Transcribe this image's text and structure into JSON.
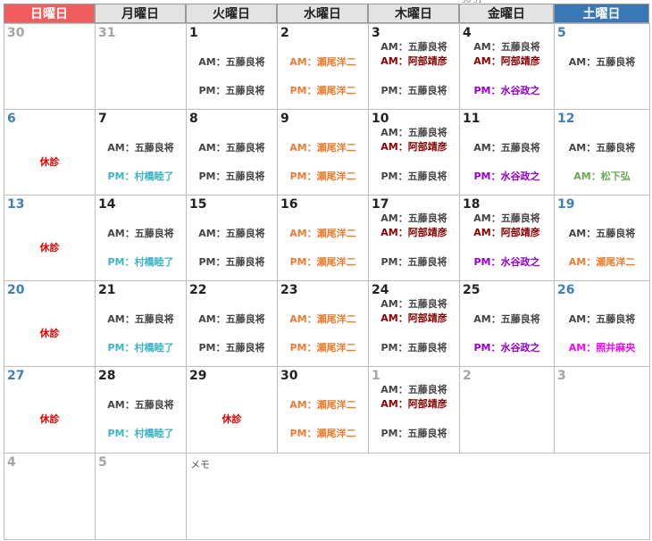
{
  "headers": [
    {
      "label": "日曜日",
      "bg": "#f25c5c",
      "fg": "#ffffff"
    },
    {
      "label": "月曜日",
      "bg": "#e3e3e3",
      "fg": "#222222"
    },
    {
      "label": "火曜日",
      "bg": "#e3e3e3",
      "fg": "#222222"
    },
    {
      "label": "水曜日",
      "bg": "#e3e3e3",
      "fg": "#222222"
    },
    {
      "label": "木曜日",
      "bg": "#e3e3e3",
      "fg": "#222222"
    },
    {
      "label": "金曜日",
      "bg": "#e3e3e3",
      "fg": "#222222"
    },
    {
      "label": "土曜日",
      "bg": "#3a78b5",
      "fg": "#ffffff"
    }
  ],
  "top_note": "30 31",
  "colors": {
    "dark": "#222222",
    "gray": "#a5a5a5",
    "sunday": "#3f7fb5",
    "saturday": "#3f7fb5",
    "holiday": "#dd0000",
    "am5": "#444444",
    "pm5": "#444444",
    "seo": "#ed7d31",
    "abe": "#8b0000",
    "mizu": "#9900cc",
    "mura": "#3ab4c6",
    "matsu": "#6aa84f",
    "teru": "#ff00ff"
  },
  "memo": "メモ",
  "weeks": [
    [
      {
        "n": "30",
        "nc": "gray",
        "lines": []
      },
      {
        "n": "31",
        "nc": "gray",
        "lines": []
      },
      {
        "n": "1",
        "nc": "dark",
        "lines": [
          {
            "t": "AM：五藤良将",
            "c": "am5",
            "y": 36
          },
          {
            "t": "PM：五藤良将",
            "c": "pm5",
            "y": 68
          }
        ]
      },
      {
        "n": "2",
        "nc": "dark",
        "lines": [
          {
            "t": "AM：瀬尾洋二",
            "c": "seo",
            "y": 36
          },
          {
            "t": "PM：瀬尾洋二",
            "c": "seo",
            "y": 68
          }
        ]
      },
      {
        "n": "3",
        "nc": "dark",
        "lines": [
          {
            "t": "AM：五藤良将",
            "c": "am5",
            "y": 19
          },
          {
            "t": "AM：阿部靖彦",
            "c": "abe",
            "y": 35
          },
          {
            "t": "PM：五藤良将",
            "c": "pm5",
            "y": 68
          }
        ]
      },
      {
        "n": "4",
        "nc": "dark",
        "lines": [
          {
            "t": "AM：五藤良将",
            "c": "am5",
            "y": 19
          },
          {
            "t": "AM：阿部靖彦",
            "c": "abe",
            "y": 35
          },
          {
            "t": "PM：水谷政之",
            "c": "mizu",
            "y": 68
          }
        ]
      },
      {
        "n": "5",
        "nc": "saturday",
        "lines": [
          {
            "t": "AM：五藤良将",
            "c": "am5",
            "y": 36
          }
        ]
      }
    ],
    [
      {
        "n": "6",
        "nc": "sunday",
        "lines": [
          {
            "t": "休診",
            "c": "holiday",
            "y": 52
          }
        ]
      },
      {
        "n": "7",
        "nc": "dark",
        "lines": [
          {
            "t": "AM：五藤良将",
            "c": "am5",
            "y": 36
          },
          {
            "t": "PM：村橋睦了",
            "c": "mura",
            "y": 68
          }
        ]
      },
      {
        "n": "8",
        "nc": "dark",
        "lines": [
          {
            "t": "AM：五藤良将",
            "c": "am5",
            "y": 36
          },
          {
            "t": "PM：五藤良将",
            "c": "pm5",
            "y": 68
          }
        ]
      },
      {
        "n": "9",
        "nc": "dark",
        "lines": [
          {
            "t": "AM：瀬尾洋二",
            "c": "seo",
            "y": 36
          },
          {
            "t": "PM：瀬尾洋二",
            "c": "seo",
            "y": 68
          }
        ]
      },
      {
        "n": "10",
        "nc": "dark",
        "lines": [
          {
            "t": "AM：五藤良将",
            "c": "am5",
            "y": 19
          },
          {
            "t": "AM：阿部靖彦",
            "c": "abe",
            "y": 35
          },
          {
            "t": "PM：五藤良将",
            "c": "pm5",
            "y": 68
          }
        ]
      },
      {
        "n": "11",
        "nc": "dark",
        "lines": [
          {
            "t": "AM：五藤良将",
            "c": "am5",
            "y": 36
          },
          {
            "t": "PM：水谷政之",
            "c": "mizu",
            "y": 68
          }
        ]
      },
      {
        "n": "12",
        "nc": "saturday",
        "lines": [
          {
            "t": "AM：五藤良将",
            "c": "am5",
            "y": 36
          },
          {
            "t": "AM：松下弘",
            "c": "matsu",
            "y": 68
          }
        ]
      }
    ],
    [
      {
        "n": "13",
        "nc": "sunday",
        "lines": [
          {
            "t": "休診",
            "c": "holiday",
            "y": 52
          }
        ]
      },
      {
        "n": "14",
        "nc": "dark",
        "lines": [
          {
            "t": "AM：五藤良将",
            "c": "am5",
            "y": 36
          },
          {
            "t": "PM：村橋睦了",
            "c": "mura",
            "y": 68
          }
        ]
      },
      {
        "n": "15",
        "nc": "dark",
        "lines": [
          {
            "t": "AM：五藤良将",
            "c": "am5",
            "y": 36
          },
          {
            "t": "PM：五藤良将",
            "c": "pm5",
            "y": 68
          }
        ]
      },
      {
        "n": "16",
        "nc": "dark",
        "lines": [
          {
            "t": "AM：瀬尾洋二",
            "c": "seo",
            "y": 36
          },
          {
            "t": "PM：瀬尾洋二",
            "c": "seo",
            "y": 68
          }
        ]
      },
      {
        "n": "17",
        "nc": "dark",
        "lines": [
          {
            "t": "AM：五藤良将",
            "c": "am5",
            "y": 19
          },
          {
            "t": "AM：阿部靖彦",
            "c": "abe",
            "y": 35
          },
          {
            "t": "PM：五藤良将",
            "c": "pm5",
            "y": 68
          }
        ]
      },
      {
        "n": "18",
        "nc": "dark",
        "lines": [
          {
            "t": "AM：五藤良将",
            "c": "am5",
            "y": 19
          },
          {
            "t": "AM：阿部靖彦",
            "c": "abe",
            "y": 35
          },
          {
            "t": "PM：水谷政之",
            "c": "mizu",
            "y": 68
          }
        ]
      },
      {
        "n": "19",
        "nc": "saturday",
        "lines": [
          {
            "t": "AM：五藤良将",
            "c": "am5",
            "y": 36
          },
          {
            "t": "AM：瀬尾洋二",
            "c": "seo",
            "y": 68
          }
        ]
      }
    ],
    [
      {
        "n": "20",
        "nc": "sunday",
        "lines": [
          {
            "t": "休診",
            "c": "holiday",
            "y": 52
          }
        ]
      },
      {
        "n": "21",
        "nc": "dark",
        "lines": [
          {
            "t": "AM：五藤良将",
            "c": "am5",
            "y": 36
          },
          {
            "t": "PM：村橋睦了",
            "c": "mura",
            "y": 68
          }
        ]
      },
      {
        "n": "22",
        "nc": "dark",
        "lines": [
          {
            "t": "AM：五藤良将",
            "c": "am5",
            "y": 36
          },
          {
            "t": "PM：五藤良将",
            "c": "pm5",
            "y": 68
          }
        ]
      },
      {
        "n": "23",
        "nc": "dark",
        "lines": [
          {
            "t": "AM：瀬尾洋二",
            "c": "seo",
            "y": 36
          },
          {
            "t": "PM：瀬尾洋二",
            "c": "seo",
            "y": 68
          }
        ]
      },
      {
        "n": "24",
        "nc": "dark",
        "lines": [
          {
            "t": "AM：五藤良将",
            "c": "am5",
            "y": 19
          },
          {
            "t": "AM：阿部靖彦",
            "c": "abe",
            "y": 35
          },
          {
            "t": "PM：五藤良将",
            "c": "pm5",
            "y": 68
          }
        ]
      },
      {
        "n": "25",
        "nc": "dark",
        "lines": [
          {
            "t": "AM：五藤良将",
            "c": "am5",
            "y": 36
          },
          {
            "t": "PM：水谷政之",
            "c": "mizu",
            "y": 68
          }
        ]
      },
      {
        "n": "26",
        "nc": "saturday",
        "lines": [
          {
            "t": "AM：五藤良将",
            "c": "am5",
            "y": 36
          },
          {
            "t": "AM：照井麻央",
            "c": "teru",
            "y": 68
          }
        ]
      }
    ],
    [
      {
        "n": "27",
        "nc": "sunday",
        "lines": [
          {
            "t": "休診",
            "c": "holiday",
            "y": 52
          }
        ]
      },
      {
        "n": "28",
        "nc": "dark",
        "lines": [
          {
            "t": "AM：五藤良将",
            "c": "am5",
            "y": 36
          },
          {
            "t": "PM：村橋睦了",
            "c": "mura",
            "y": 68
          }
        ]
      },
      {
        "n": "29",
        "nc": "dark",
        "lines": [
          {
            "t": "休診",
            "c": "holiday",
            "y": 52
          }
        ]
      },
      {
        "n": "30",
        "nc": "dark",
        "lines": [
          {
            "t": "AM：瀬尾洋二",
            "c": "seo",
            "y": 36
          },
          {
            "t": "PM：瀬尾洋二",
            "c": "seo",
            "y": 68
          }
        ]
      },
      {
        "n": "1",
        "nc": "gray",
        "lines": [
          {
            "t": "AM：五藤良将",
            "c": "am5",
            "y": 19
          },
          {
            "t": "AM：阿部靖彦",
            "c": "abe",
            "y": 35
          },
          {
            "t": "PM：五藤良将",
            "c": "pm5",
            "y": 68
          }
        ]
      },
      {
        "n": "2",
        "nc": "gray",
        "lines": []
      },
      {
        "n": "3",
        "nc": "gray",
        "lines": []
      }
    ],
    [
      {
        "n": "4",
        "nc": "gray",
        "lines": []
      },
      {
        "n": "5",
        "nc": "gray",
        "lines": []
      }
    ]
  ]
}
